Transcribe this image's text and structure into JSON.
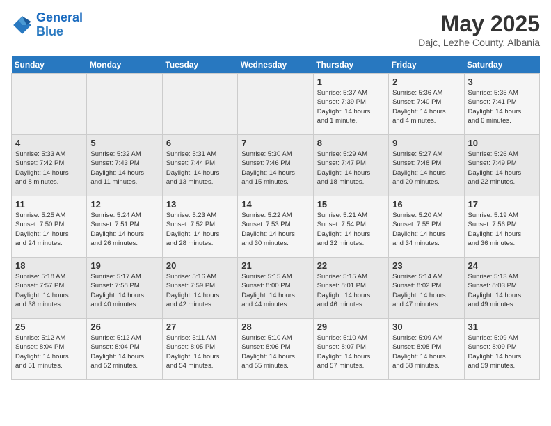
{
  "header": {
    "logo_line1": "General",
    "logo_line2": "Blue",
    "month_title": "May 2025",
    "location": "Dajc, Lezhe County, Albania"
  },
  "days_of_week": [
    "Sunday",
    "Monday",
    "Tuesday",
    "Wednesday",
    "Thursday",
    "Friday",
    "Saturday"
  ],
  "weeks": [
    [
      {
        "num": "",
        "info": ""
      },
      {
        "num": "",
        "info": ""
      },
      {
        "num": "",
        "info": ""
      },
      {
        "num": "",
        "info": ""
      },
      {
        "num": "1",
        "info": "Sunrise: 5:37 AM\nSunset: 7:39 PM\nDaylight: 14 hours\nand 1 minute."
      },
      {
        "num": "2",
        "info": "Sunrise: 5:36 AM\nSunset: 7:40 PM\nDaylight: 14 hours\nand 4 minutes."
      },
      {
        "num": "3",
        "info": "Sunrise: 5:35 AM\nSunset: 7:41 PM\nDaylight: 14 hours\nand 6 minutes."
      }
    ],
    [
      {
        "num": "4",
        "info": "Sunrise: 5:33 AM\nSunset: 7:42 PM\nDaylight: 14 hours\nand 8 minutes."
      },
      {
        "num": "5",
        "info": "Sunrise: 5:32 AM\nSunset: 7:43 PM\nDaylight: 14 hours\nand 11 minutes."
      },
      {
        "num": "6",
        "info": "Sunrise: 5:31 AM\nSunset: 7:44 PM\nDaylight: 14 hours\nand 13 minutes."
      },
      {
        "num": "7",
        "info": "Sunrise: 5:30 AM\nSunset: 7:46 PM\nDaylight: 14 hours\nand 15 minutes."
      },
      {
        "num": "8",
        "info": "Sunrise: 5:29 AM\nSunset: 7:47 PM\nDaylight: 14 hours\nand 18 minutes."
      },
      {
        "num": "9",
        "info": "Sunrise: 5:27 AM\nSunset: 7:48 PM\nDaylight: 14 hours\nand 20 minutes."
      },
      {
        "num": "10",
        "info": "Sunrise: 5:26 AM\nSunset: 7:49 PM\nDaylight: 14 hours\nand 22 minutes."
      }
    ],
    [
      {
        "num": "11",
        "info": "Sunrise: 5:25 AM\nSunset: 7:50 PM\nDaylight: 14 hours\nand 24 minutes."
      },
      {
        "num": "12",
        "info": "Sunrise: 5:24 AM\nSunset: 7:51 PM\nDaylight: 14 hours\nand 26 minutes."
      },
      {
        "num": "13",
        "info": "Sunrise: 5:23 AM\nSunset: 7:52 PM\nDaylight: 14 hours\nand 28 minutes."
      },
      {
        "num": "14",
        "info": "Sunrise: 5:22 AM\nSunset: 7:53 PM\nDaylight: 14 hours\nand 30 minutes."
      },
      {
        "num": "15",
        "info": "Sunrise: 5:21 AM\nSunset: 7:54 PM\nDaylight: 14 hours\nand 32 minutes."
      },
      {
        "num": "16",
        "info": "Sunrise: 5:20 AM\nSunset: 7:55 PM\nDaylight: 14 hours\nand 34 minutes."
      },
      {
        "num": "17",
        "info": "Sunrise: 5:19 AM\nSunset: 7:56 PM\nDaylight: 14 hours\nand 36 minutes."
      }
    ],
    [
      {
        "num": "18",
        "info": "Sunrise: 5:18 AM\nSunset: 7:57 PM\nDaylight: 14 hours\nand 38 minutes."
      },
      {
        "num": "19",
        "info": "Sunrise: 5:17 AM\nSunset: 7:58 PM\nDaylight: 14 hours\nand 40 minutes."
      },
      {
        "num": "20",
        "info": "Sunrise: 5:16 AM\nSunset: 7:59 PM\nDaylight: 14 hours\nand 42 minutes."
      },
      {
        "num": "21",
        "info": "Sunrise: 5:15 AM\nSunset: 8:00 PM\nDaylight: 14 hours\nand 44 minutes."
      },
      {
        "num": "22",
        "info": "Sunrise: 5:15 AM\nSunset: 8:01 PM\nDaylight: 14 hours\nand 46 minutes."
      },
      {
        "num": "23",
        "info": "Sunrise: 5:14 AM\nSunset: 8:02 PM\nDaylight: 14 hours\nand 47 minutes."
      },
      {
        "num": "24",
        "info": "Sunrise: 5:13 AM\nSunset: 8:03 PM\nDaylight: 14 hours\nand 49 minutes."
      }
    ],
    [
      {
        "num": "25",
        "info": "Sunrise: 5:12 AM\nSunset: 8:04 PM\nDaylight: 14 hours\nand 51 minutes."
      },
      {
        "num": "26",
        "info": "Sunrise: 5:12 AM\nSunset: 8:04 PM\nDaylight: 14 hours\nand 52 minutes."
      },
      {
        "num": "27",
        "info": "Sunrise: 5:11 AM\nSunset: 8:05 PM\nDaylight: 14 hours\nand 54 minutes."
      },
      {
        "num": "28",
        "info": "Sunrise: 5:10 AM\nSunset: 8:06 PM\nDaylight: 14 hours\nand 55 minutes."
      },
      {
        "num": "29",
        "info": "Sunrise: 5:10 AM\nSunset: 8:07 PM\nDaylight: 14 hours\nand 57 minutes."
      },
      {
        "num": "30",
        "info": "Sunrise: 5:09 AM\nSunset: 8:08 PM\nDaylight: 14 hours\nand 58 minutes."
      },
      {
        "num": "31",
        "info": "Sunrise: 5:09 AM\nSunset: 8:09 PM\nDaylight: 14 hours\nand 59 minutes."
      }
    ]
  ]
}
